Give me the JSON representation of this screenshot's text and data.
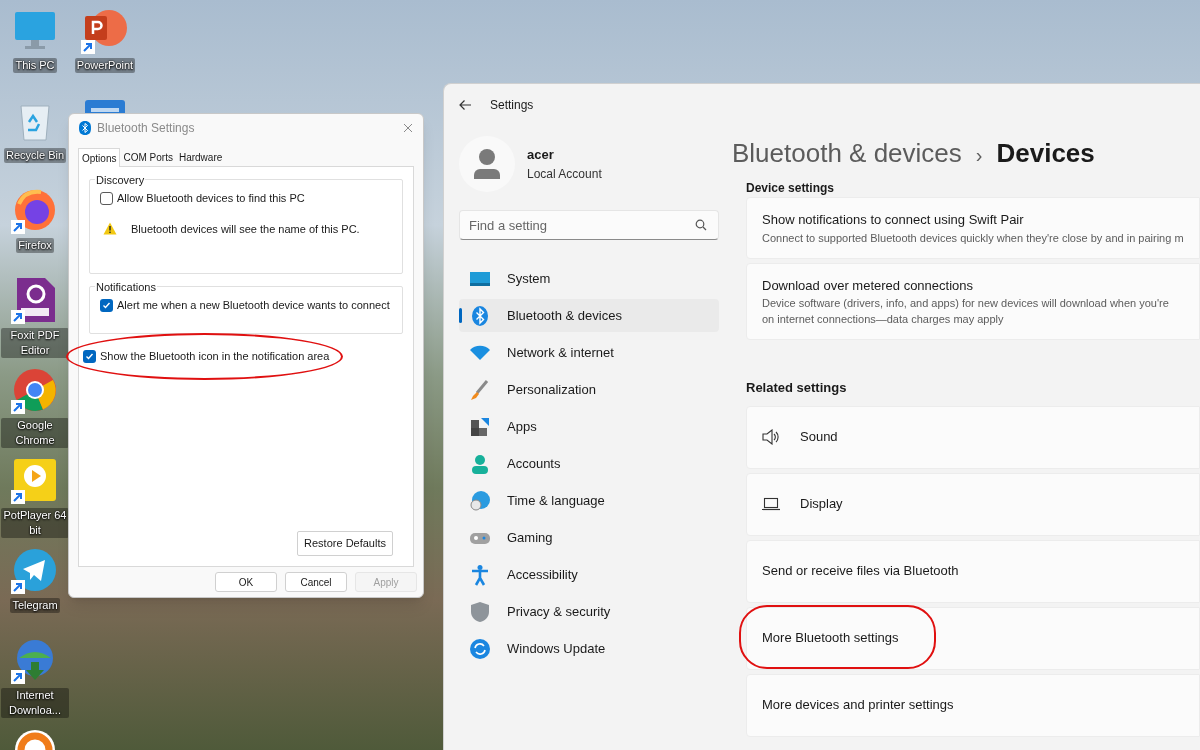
{
  "desktop": {
    "icons": [
      {
        "label": "This PC",
        "kind": "monitor",
        "shortcut": false
      },
      {
        "label": "Recycle Bin",
        "kind": "recycle",
        "shortcut": false
      },
      {
        "label": "Firefox",
        "kind": "firefox",
        "shortcut": true
      },
      {
        "label": "Foxit PDF Editor",
        "kind": "foxit",
        "shortcut": true
      },
      {
        "label": "Google Chrome",
        "kind": "chrome",
        "shortcut": true
      },
      {
        "label": "PotPlayer 64 bit",
        "kind": "potplayer",
        "shortcut": true
      },
      {
        "label": "Telegram",
        "kind": "telegram",
        "shortcut": true
      },
      {
        "label": "Internet Downloa...",
        "kind": "idm",
        "shortcut": true
      },
      {
        "kind": "ring"
      },
      {
        "label": "PowerPoint",
        "kind": "powerpoint",
        "shortcut": true
      },
      {
        "kind": "word"
      }
    ]
  },
  "bluetooth_dialog": {
    "title": "Bluetooth Settings",
    "tabs": [
      {
        "label": "Options",
        "selected": true
      },
      {
        "label": "COM Ports",
        "selected": false
      },
      {
        "label": "Hardware",
        "selected": false
      }
    ],
    "groups": [
      {
        "title": "Discovery",
        "items": [
          {
            "kind": "checkbox",
            "label": "Allow Bluetooth devices to find this PC",
            "checked": false
          },
          {
            "kind": "warning",
            "label": "Bluetooth devices will see the name of this PC."
          }
        ]
      },
      {
        "title": "Notifications",
        "items": [
          {
            "kind": "checkbox",
            "label": "Alert me when a new Bluetooth device wants to connect",
            "checked": true
          }
        ]
      }
    ],
    "options": [
      {
        "label": "Show the Bluetooth icon in the notification area",
        "checked": true,
        "highlighted": true
      }
    ],
    "restore_button": "Restore Defaults",
    "buttons": [
      {
        "label": "OK",
        "disabled": false
      },
      {
        "label": "Cancel",
        "disabled": false
      },
      {
        "label": "Apply",
        "disabled": true
      }
    ]
  },
  "settings_window": {
    "title": "Settings",
    "account": {
      "name": "acer",
      "type": "Local Account"
    },
    "search": {
      "placeholder": "Find a setting"
    },
    "nav": [
      {
        "label": "System",
        "kind": "system",
        "selected": false
      },
      {
        "label": "Bluetooth & devices",
        "kind": "bluetooth",
        "selected": true
      },
      {
        "label": "Network & internet",
        "kind": "network",
        "selected": false
      },
      {
        "label": "Personalization",
        "kind": "brush",
        "selected": false
      },
      {
        "label": "Apps",
        "kind": "apps",
        "selected": false
      },
      {
        "label": "Accounts",
        "kind": "accounts",
        "selected": false
      },
      {
        "label": "Time & language",
        "kind": "time",
        "selected": false
      },
      {
        "label": "Gaming",
        "kind": "gaming",
        "selected": false
      },
      {
        "label": "Accessibility",
        "kind": "accessibility",
        "selected": false
      },
      {
        "label": "Privacy & security",
        "kind": "shield",
        "selected": false
      },
      {
        "label": "Windows Update",
        "kind": "update",
        "selected": false
      }
    ],
    "breadcrumb": {
      "parent": "Bluetooth & devices",
      "separator": "›",
      "current": "Devices"
    },
    "sections": [
      {
        "heading": "Device settings",
        "cards": [
          {
            "title": "Show notifications to connect using Swift Pair",
            "description": "Connect to supported Bluetooth devices quickly when they're close by and in pairing m",
            "highlighted": false
          },
          {
            "title": "Download over metered connections",
            "description": "Device software (drivers, info, and apps) for new devices will download when you're on internet connections—data charges may apply",
            "highlighted": false
          }
        ]
      },
      {
        "heading": "Related settings",
        "cards": [
          {
            "title": "Sound",
            "kind": "speaker",
            "highlighted": false
          },
          {
            "title": "Display",
            "kind": "laptop",
            "highlighted": false
          },
          {
            "title": "Send or receive files via Bluetooth",
            "highlighted": false
          },
          {
            "title": "More Bluetooth settings",
            "highlighted": true
          },
          {
            "title": "More devices and printer settings",
            "highlighted": false
          }
        ]
      }
    ]
  }
}
